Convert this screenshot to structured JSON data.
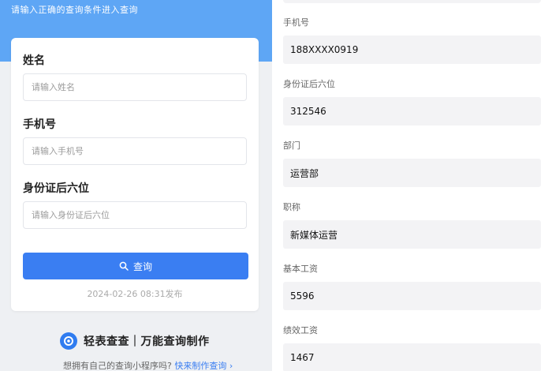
{
  "query_form": {
    "hint": "请输入正确的查询条件进入查询",
    "fields": [
      {
        "label": "姓名",
        "placeholder": "请输入姓名"
      },
      {
        "label": "手机号",
        "placeholder": "请输入手机号"
      },
      {
        "label": "身份证后六位",
        "placeholder": "请输入身份证后六位"
      }
    ],
    "search_label": "查询",
    "published": "2024-02-26 08:31发布"
  },
  "branding": {
    "title": "轻表查查｜万能查询制作",
    "footer_text": "想拥有自己的查询小程序吗?",
    "footer_link": "快来制作查询",
    "footer_arrow": "›"
  },
  "result": {
    "fields": [
      {
        "label": "手机号",
        "value": "188XXXX0919"
      },
      {
        "label": "身份证后六位",
        "value": "312546"
      },
      {
        "label": "部门",
        "value": "运营部"
      },
      {
        "label": "职称",
        "value": "新媒体运营"
      },
      {
        "label": "基本工资",
        "value": "5596"
      },
      {
        "label": "绩效工资",
        "value": "1467"
      }
    ]
  },
  "colors": {
    "primary": "#3a7ef2",
    "header_blue": "#5ea6f5"
  }
}
